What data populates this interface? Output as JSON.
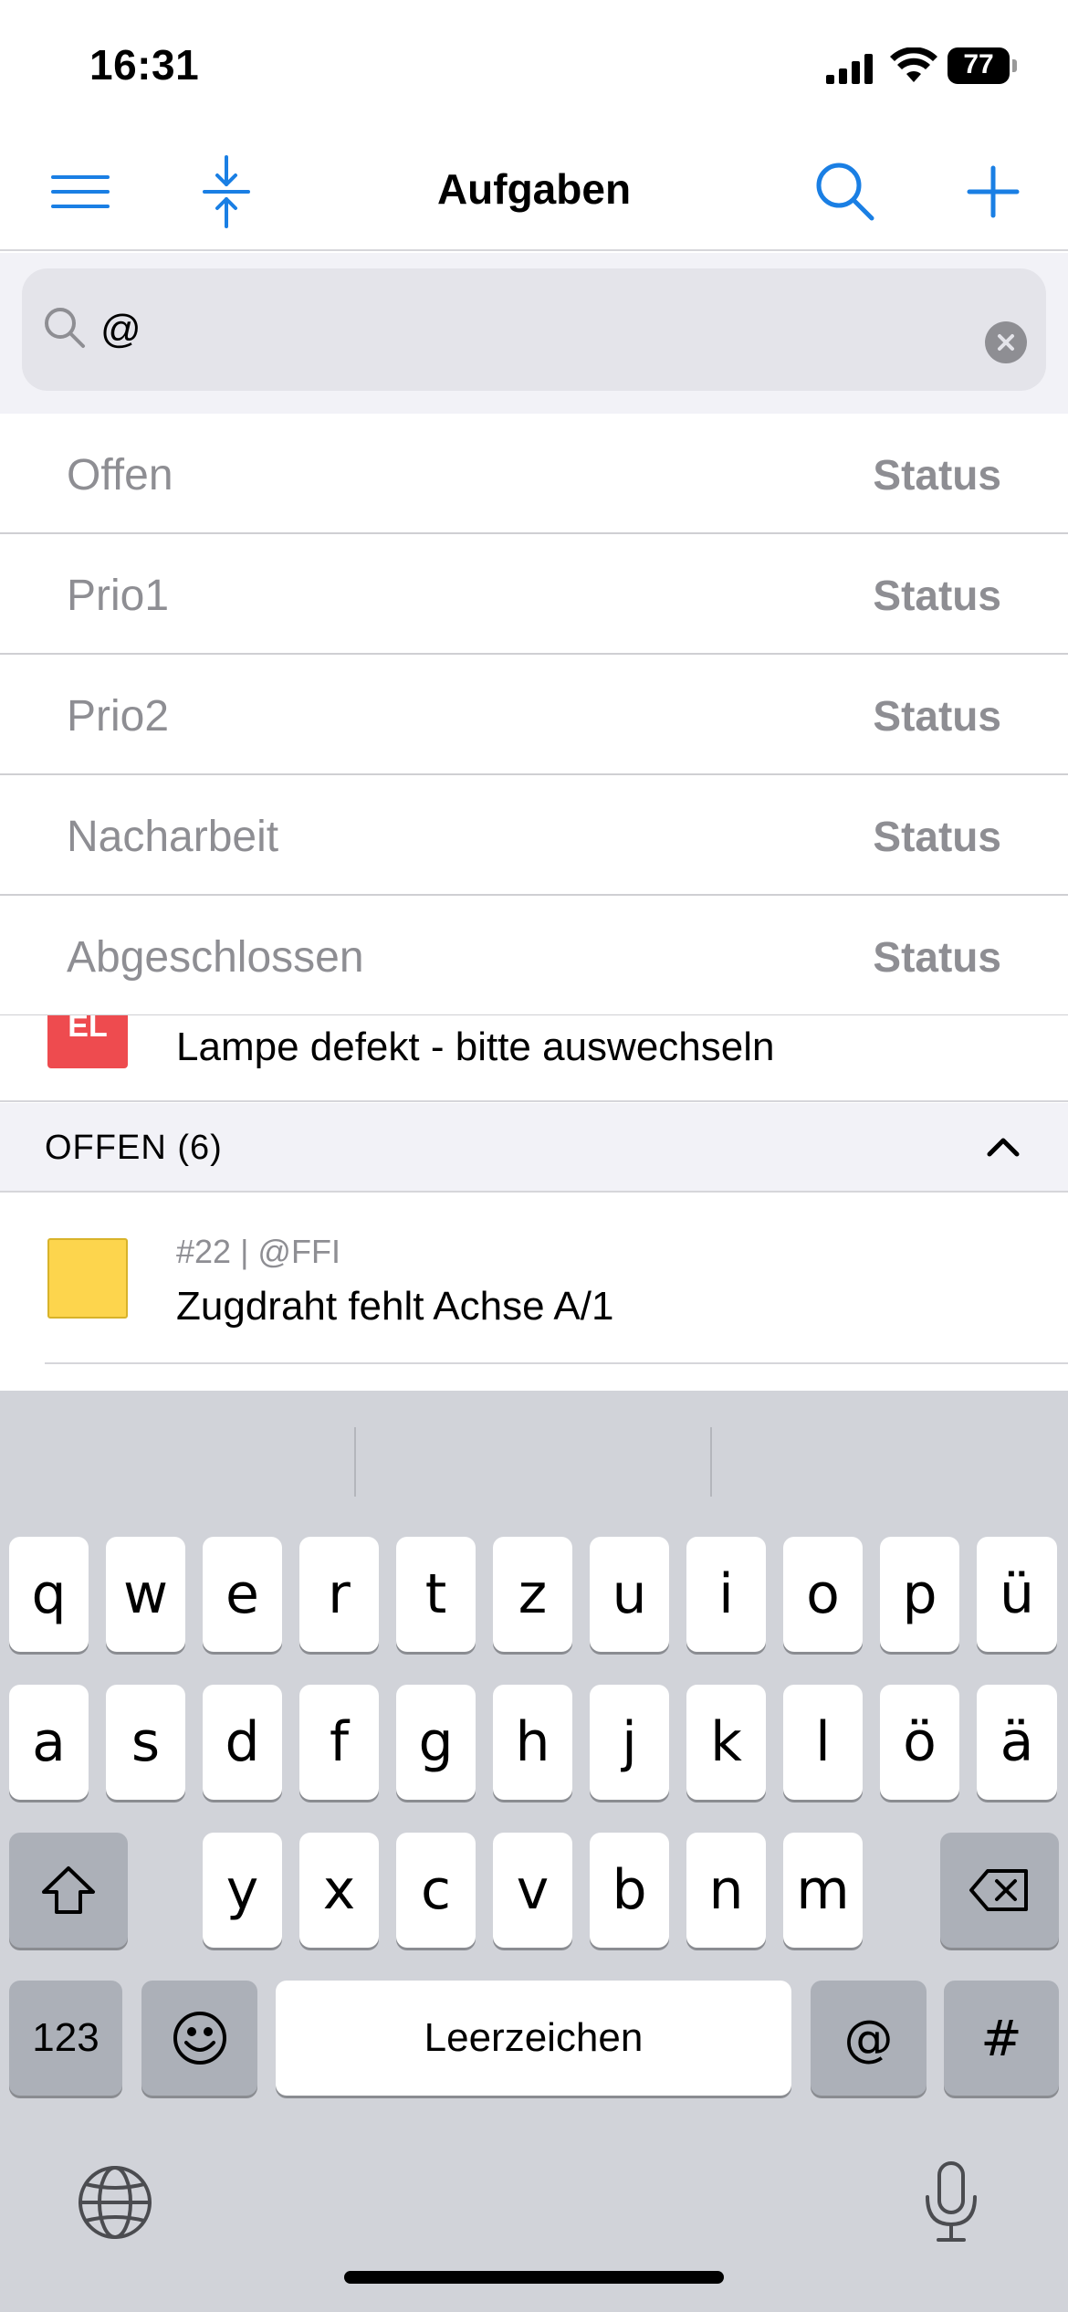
{
  "status_bar": {
    "time": "16:31",
    "battery": "77"
  },
  "nav": {
    "title": "Aufgaben",
    "icons": [
      "menu-icon",
      "collapse-icon",
      "search-icon",
      "plus-icon"
    ],
    "accent": "#1a7fe4"
  },
  "search": {
    "value": "@"
  },
  "filters": [
    {
      "label": "Offen",
      "status": "Status"
    },
    {
      "label": "Prio1",
      "status": "Status"
    },
    {
      "label": "Prio2",
      "status": "Status"
    },
    {
      "label": "Nacharbeit",
      "status": "Status"
    },
    {
      "label": "Abgeschlossen",
      "status": "Status"
    }
  ],
  "tasks_partial": {
    "tag": "EL",
    "title": "Lampe defekt - bitte auswechseln",
    "tag_color": "#ee4b4f"
  },
  "section": {
    "title": "OFFEN (6)"
  },
  "task": {
    "meta": "#22 | @FFI",
    "title": "Zugdraht fehlt Achse A/1",
    "color": "#fdd54d"
  },
  "keyboard": {
    "row1": [
      "q",
      "w",
      "e",
      "r",
      "t",
      "z",
      "u",
      "i",
      "o",
      "p",
      "ü"
    ],
    "row2": [
      "a",
      "s",
      "d",
      "f",
      "g",
      "h",
      "j",
      "k",
      "l",
      "ö",
      "ä"
    ],
    "row3": [
      "y",
      "x",
      "c",
      "v",
      "b",
      "n",
      "m"
    ],
    "numbers_key": "123",
    "space_key": "Leerzeichen",
    "at_key": "@",
    "hash_key": "#"
  }
}
